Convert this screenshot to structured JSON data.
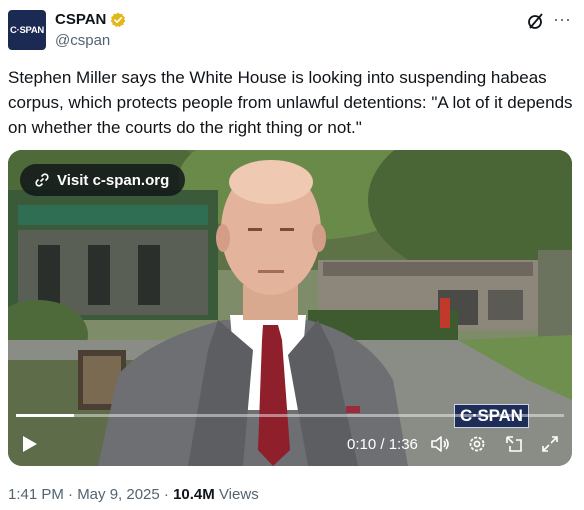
{
  "header": {
    "avatar_text": "C·SPAN",
    "display_name": "CSPAN",
    "handle": "@cspan",
    "verified_icon": "gold-check-badge-icon",
    "more_icon": "more-dots-icon",
    "grok_icon": "grok-icon"
  },
  "tweet": {
    "text": "Stephen Miller says the White House is looking into suspending habeas corpus, which protects people from unlawful detentions: \"A lot of it depends on whether the courts do the right thing or not.\""
  },
  "video": {
    "link_label": "Visit c-span.org",
    "watermark": "C·SPAN",
    "time_display": "0:10 / 1:36",
    "progress_fraction": 0.106,
    "controls": [
      "play-icon",
      "volume-icon",
      "settings-icon",
      "pip-icon",
      "fullscreen-icon"
    ]
  },
  "footer": {
    "timestamp": "1:41 PM · May 9, 2025 · ",
    "views_count": "10.4M",
    "views_label": " Views"
  },
  "colors": {
    "verified_gold": "#e2b719",
    "cspan_navy": "#1e2d57",
    "muted_text": "#536471"
  }
}
